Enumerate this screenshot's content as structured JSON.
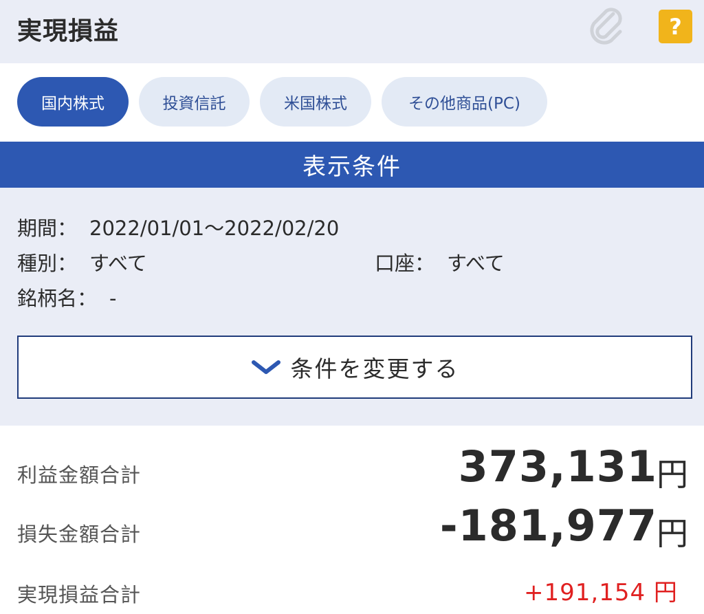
{
  "header": {
    "title": "実現損益",
    "clip_icon": "paperclip-icon",
    "help_label": "?"
  },
  "tabs": [
    {
      "label": "国内株式",
      "active": true
    },
    {
      "label": "投資信託",
      "active": false
    },
    {
      "label": "米国株式",
      "active": false
    },
    {
      "label": "その他商品(PC)",
      "active": false
    }
  ],
  "conditions": {
    "heading": "表示条件",
    "period_label": "期間：",
    "period_value": "2022/01/01～2022/02/20",
    "type_label": "種別：",
    "type_value": "すべて",
    "account_label": "口座：",
    "account_value": "すべて",
    "name_label": "銘柄名：",
    "name_value": "-",
    "change_button": "条件を変更する"
  },
  "summary": {
    "profit_label": "利益金額合計",
    "profit_value": "373,131",
    "loss_label": "損失金額合計",
    "loss_value": "-181,977",
    "total_label": "実現損益合計",
    "total_value": "+191,154 円",
    "unit": "円"
  },
  "colors": {
    "accent": "#2d58b2",
    "panel": "#eaedf6",
    "positive": "#e02020",
    "help": "#f1b41b"
  }
}
